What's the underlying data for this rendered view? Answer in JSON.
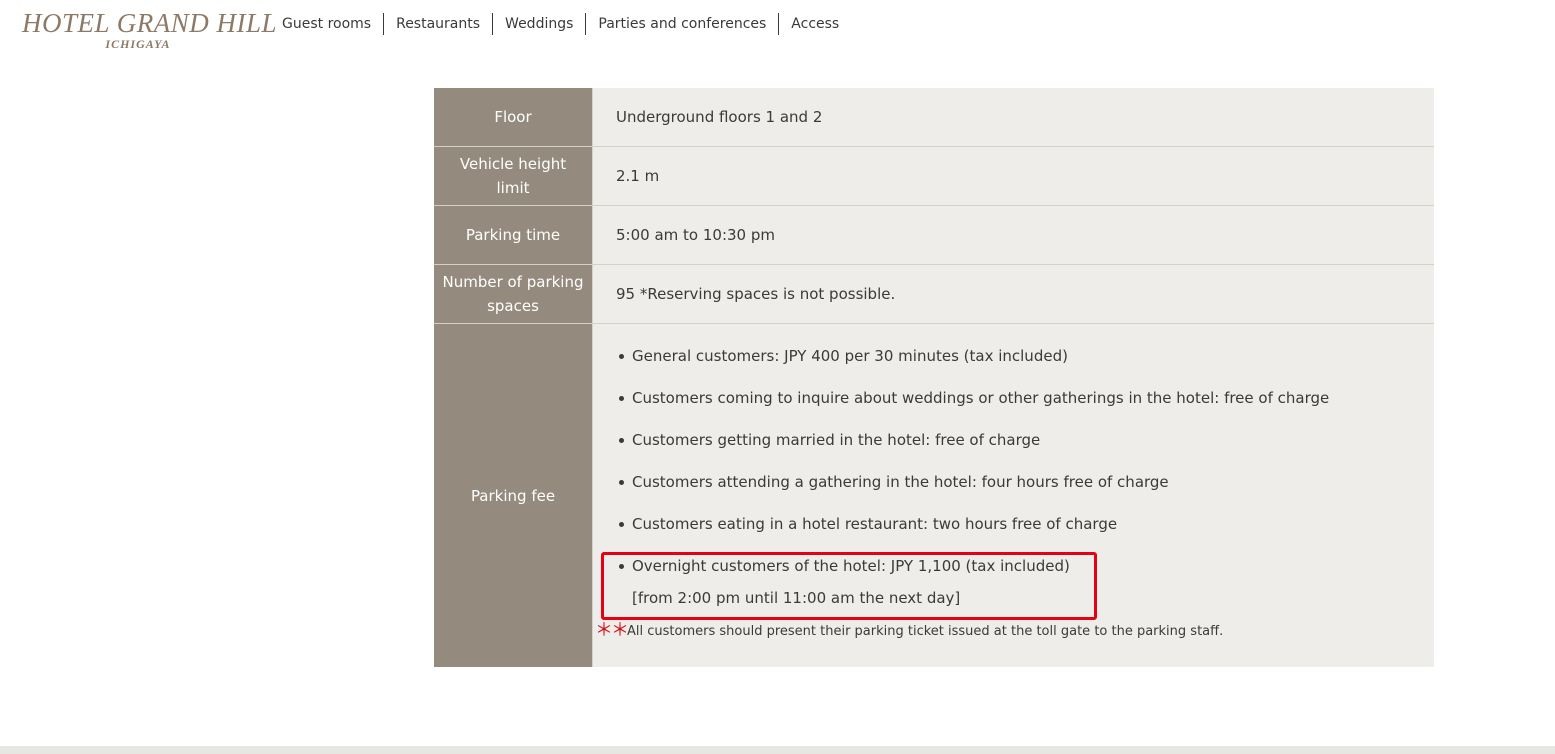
{
  "header": {
    "logo_main": "HOTEL GRAND HILL",
    "logo_sub": "ICHIGAYA",
    "nav": [
      {
        "label": "Guest rooms"
      },
      {
        "label": "Restaurants"
      },
      {
        "label": "Weddings"
      },
      {
        "label": "Parties and conferences"
      },
      {
        "label": "Access"
      }
    ]
  },
  "parking_table": {
    "rows": [
      {
        "label": "Floor",
        "value": "Underground floors 1 and 2"
      },
      {
        "label": "Vehicle height limit",
        "value": "2.1 m"
      },
      {
        "label": "Parking time",
        "value": "5:00 am to 10:30 pm"
      },
      {
        "label": "Number of parking spaces",
        "value": "95 *Reserving spaces is not possible."
      }
    ],
    "fee": {
      "label": "Parking fee",
      "items": [
        "General customers: JPY 400 per 30 minutes (tax included)",
        "Customers coming to inquire about weddings or other gatherings in the hotel: free of charge",
        "Customers getting married in the hotel: free of charge",
        "Customers attending a gathering in the hotel: four hours free of charge",
        "Customers eating in a hotel restaurant: two hours free of charge"
      ],
      "overnight": "Overnight customers of the hotel: JPY 1,100 (tax included)",
      "overnight_hours": "[from 2:00 pm until 11:00 am the next day]",
      "note_mark": "＊＊",
      "note": "All customers should present their parking ticket issued at the toll gate to the parking staff."
    }
  },
  "colors": {
    "header_cell": "#948a7e",
    "value_cell": "#efede9",
    "highlight": "#e50012",
    "logo": "#8c7a66"
  }
}
